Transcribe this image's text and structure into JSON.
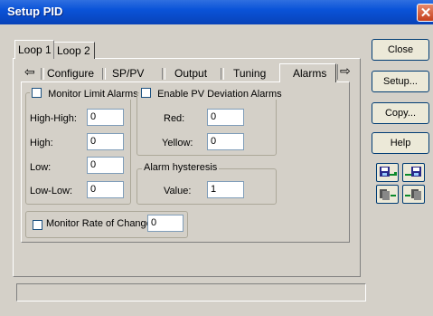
{
  "window": {
    "title": "Setup PID"
  },
  "loop_tabs": [
    "Loop 1",
    "Loop 2"
  ],
  "sub_tabs": [
    "Configure",
    "SP/PV",
    "Output",
    "Tuning",
    "Alarms"
  ],
  "monitor_limit": {
    "label": "Monitor Limit Alarms",
    "rows": [
      {
        "label": "High-High:",
        "value": "0"
      },
      {
        "label": "High:",
        "value": "0"
      },
      {
        "label": "Low:",
        "value": "0"
      },
      {
        "label": "Low-Low:",
        "value": "0"
      }
    ]
  },
  "pv_deviation": {
    "label": "Enable PV Deviation Alarms",
    "red_label": "Red:",
    "red_value": "0",
    "yellow_label": "Yellow:",
    "yellow_value": "0"
  },
  "hysteresis": {
    "label": "Alarm hysteresis",
    "value_label": "Value:",
    "value": "1"
  },
  "rate_of_change": {
    "label": "Monitor Rate of Change:",
    "value": "0"
  },
  "buttons": {
    "close": "Close",
    "setup": "Setup...",
    "copy": "Copy...",
    "help": "Help"
  },
  "icons": {
    "import": "import-icon",
    "export": "export-icon",
    "copy_from": "copy-from-icon",
    "copy_to": "copy-to-icon"
  }
}
